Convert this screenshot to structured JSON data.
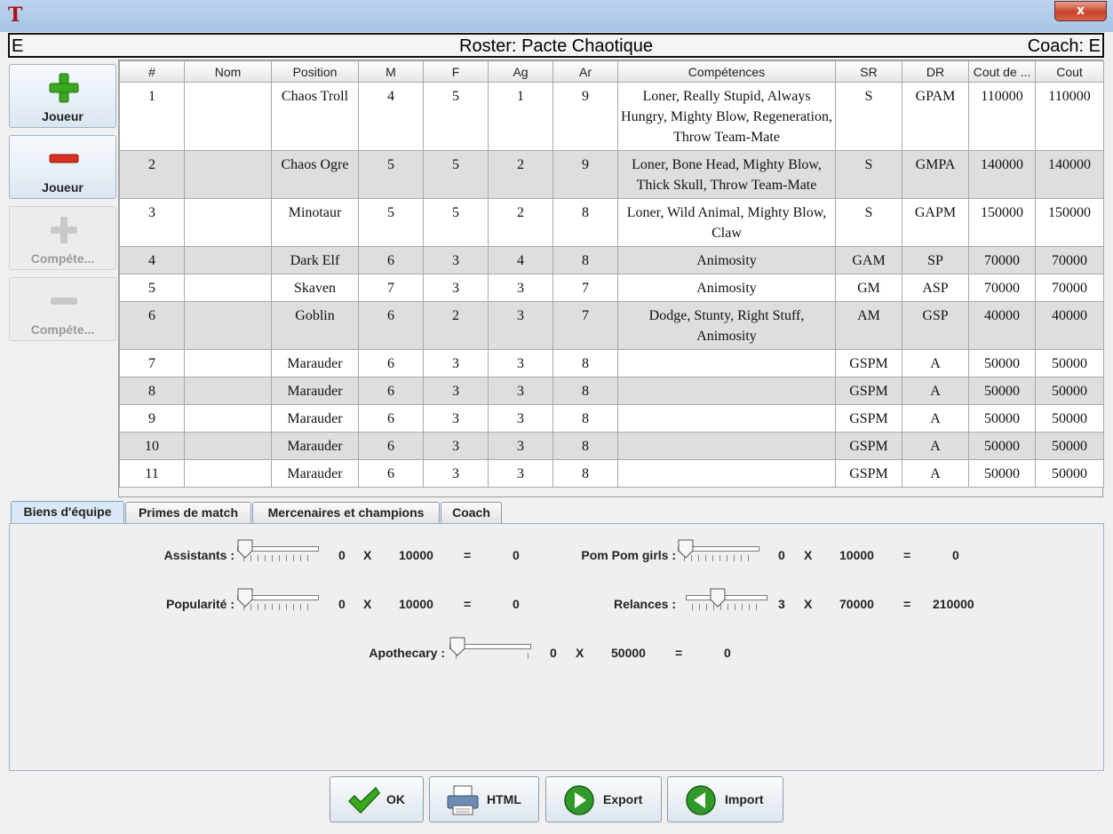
{
  "window": {
    "app_icon_glyph": "T",
    "close_glyph": "x"
  },
  "header": {
    "left_text": "E",
    "title": "Roster: Pacte Chaotique",
    "coach": "Coach: E"
  },
  "sidebar": {
    "add_player_label": "Joueur",
    "remove_player_label": "Joueur",
    "add_skill_label": "Compéte...",
    "remove_skill_label": "Compéte..."
  },
  "table": {
    "columns": [
      "#",
      "Nom",
      "Position",
      "M",
      "F",
      "Ag",
      "Ar",
      "Compétences",
      "SR",
      "DR",
      "Cout de ...",
      "Cout"
    ],
    "rows": [
      {
        "num": "1",
        "nom": "",
        "position": "Chaos Troll",
        "m": "4",
        "f": "5",
        "ag": "1",
        "ar": "9",
        "skills": "Loner, Really Stupid, Always Hungry, Mighty Blow, Regeneration, Throw Team-Mate",
        "sr": "S",
        "dr": "GPAM",
        "cost_base": "110000",
        "cost": "110000"
      },
      {
        "num": "2",
        "nom": "",
        "position": "Chaos Ogre",
        "m": "5",
        "f": "5",
        "ag": "2",
        "ar": "9",
        "skills": "Loner, Bone Head, Mighty Blow, Thick Skull, Throw Team-Mate",
        "sr": "S",
        "dr": "GMPA",
        "cost_base": "140000",
        "cost": "140000"
      },
      {
        "num": "3",
        "nom": "",
        "position": "Minotaur",
        "m": "5",
        "f": "5",
        "ag": "2",
        "ar": "8",
        "skills": "Loner, Wild Animal, Mighty Blow, Claw",
        "sr": "S",
        "dr": "GAPM",
        "cost_base": "150000",
        "cost": "150000"
      },
      {
        "num": "4",
        "nom": "",
        "position": "Dark Elf",
        "m": "6",
        "f": "3",
        "ag": "4",
        "ar": "8",
        "skills": "Animosity",
        "sr": "GAM",
        "dr": "SP",
        "cost_base": "70000",
        "cost": "70000"
      },
      {
        "num": "5",
        "nom": "",
        "position": "Skaven",
        "m": "7",
        "f": "3",
        "ag": "3",
        "ar": "7",
        "skills": "Animosity",
        "sr": "GM",
        "dr": "ASP",
        "cost_base": "70000",
        "cost": "70000"
      },
      {
        "num": "6",
        "nom": "",
        "position": "Goblin",
        "m": "6",
        "f": "2",
        "ag": "3",
        "ar": "7",
        "skills": "Dodge, Stunty, Right Stuff, Animosity",
        "sr": "AM",
        "dr": "GSP",
        "cost_base": "40000",
        "cost": "40000"
      },
      {
        "num": "7",
        "nom": "",
        "position": "Marauder",
        "m": "6",
        "f": "3",
        "ag": "3",
        "ar": "8",
        "skills": "",
        "sr": "GSPM",
        "dr": "A",
        "cost_base": "50000",
        "cost": "50000"
      },
      {
        "num": "8",
        "nom": "",
        "position": "Marauder",
        "m": "6",
        "f": "3",
        "ag": "3",
        "ar": "8",
        "skills": "",
        "sr": "GSPM",
        "dr": "A",
        "cost_base": "50000",
        "cost": "50000"
      },
      {
        "num": "9",
        "nom": "",
        "position": "Marauder",
        "m": "6",
        "f": "3",
        "ag": "3",
        "ar": "8",
        "skills": "",
        "sr": "GSPM",
        "dr": "A",
        "cost_base": "50000",
        "cost": "50000"
      },
      {
        "num": "10",
        "nom": "",
        "position": "Marauder",
        "m": "6",
        "f": "3",
        "ag": "3",
        "ar": "8",
        "skills": "",
        "sr": "GSPM",
        "dr": "A",
        "cost_base": "50000",
        "cost": "50000"
      },
      {
        "num": "11",
        "nom": "",
        "position": "Marauder",
        "m": "6",
        "f": "3",
        "ag": "3",
        "ar": "8",
        "skills": "",
        "sr": "GSPM",
        "dr": "A",
        "cost_base": "50000",
        "cost": "50000"
      }
    ]
  },
  "tabs": {
    "items": [
      {
        "label": "Biens d'équipe",
        "active": true
      },
      {
        "label": "Primes de match",
        "active": false
      },
      {
        "label": "Mercenaires et champions",
        "active": false
      },
      {
        "label": "Coach",
        "active": false
      }
    ]
  },
  "goods": {
    "assistants": {
      "label": "Assistants :",
      "qty": "0",
      "x": "X",
      "price": "10000",
      "eq": "=",
      "total": "0",
      "level": 0
    },
    "popularite": {
      "label": "Popularité :",
      "qty": "0",
      "x": "X",
      "price": "10000",
      "eq": "=",
      "total": "0",
      "level": 0
    },
    "pompom": {
      "label": "Pom Pom girls :",
      "qty": "0",
      "x": "X",
      "price": "10000",
      "eq": "=",
      "total": "0",
      "level": 0
    },
    "relances": {
      "label": "Relances :",
      "qty": "3",
      "x": "X",
      "price": "70000",
      "eq": "=",
      "total": "210000",
      "level": 0.375
    },
    "apothecary": {
      "label": "Apothecary :",
      "qty": "0",
      "x": "X",
      "price": "50000",
      "eq": "=",
      "total": "0",
      "level": 0
    }
  },
  "buttons": {
    "ok": "OK",
    "html": "HTML",
    "export": "Export",
    "import": "Import"
  },
  "colors": {
    "add_icon": "#3aa81e",
    "remove_icon": "#d92f1f",
    "disabled_icon": "#c8c8c8",
    "ok_check": "#3aa81e",
    "round_icon": "#2f9a2a"
  }
}
